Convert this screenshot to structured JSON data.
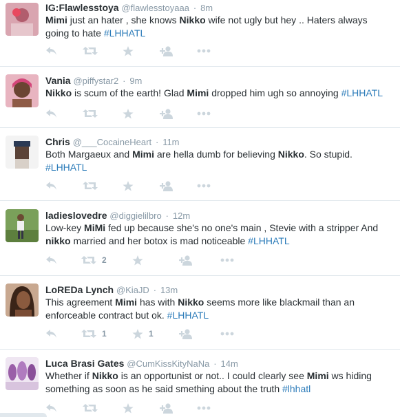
{
  "tweets": [
    {
      "name": "IG:Flawlesstoya",
      "handle": "@flawlesstoyaaa",
      "time": "8m",
      "segments": [
        {
          "t": "Mimi",
          "b": true
        },
        {
          "t": " just an hater , she knows "
        },
        {
          "t": "Nikko",
          "b": true
        },
        {
          "t": " wife not ugly but hey .. Haters always going to hate "
        },
        {
          "t": "#LHHATL",
          "tag": true
        }
      ],
      "retweets": "",
      "favorites": ""
    },
    {
      "name": "Vania",
      "handle": "@piffystar2",
      "time": "9m",
      "segments": [
        {
          "t": "Nikko",
          "b": true
        },
        {
          "t": " is scum of the earth! Glad "
        },
        {
          "t": "Mimi",
          "b": true
        },
        {
          "t": " dropped him ugh so annoying "
        },
        {
          "t": "#LHHATL",
          "tag": true
        }
      ],
      "retweets": "",
      "favorites": ""
    },
    {
      "name": "Chris",
      "handle": "@___CocaineHeart",
      "time": "11m",
      "segments": [
        {
          "t": "Both Margaeux and "
        },
        {
          "t": "Mimi",
          "b": true
        },
        {
          "t": " are hella dumb for believing "
        },
        {
          "t": "Nikko",
          "b": true
        },
        {
          "t": ". So stupid. "
        },
        {
          "t": "#LHHATL",
          "tag": true
        }
      ],
      "retweets": "",
      "favorites": ""
    },
    {
      "name": "ladieslovedre",
      "handle": "@diggielilbro",
      "time": "12m",
      "segments": [
        {
          "t": "Low-key "
        },
        {
          "t": "MiMi",
          "b": true
        },
        {
          "t": " fed up because she's no one's main , Stevie with a stripper And "
        },
        {
          "t": "nikko",
          "b": true
        },
        {
          "t": " married and her botox is mad noticeable "
        },
        {
          "t": "#LHHATL",
          "tag": true
        }
      ],
      "retweets": "2",
      "favorites": ""
    },
    {
      "name": "LoREDa Lynch",
      "handle": "@KiaJD",
      "time": "13m",
      "segments": [
        {
          "t": "This agreement "
        },
        {
          "t": "Mimi",
          "b": true
        },
        {
          "t": " has with "
        },
        {
          "t": "Nikko",
          "b": true
        },
        {
          "t": " seems more like blackmail than an enforceable contract but ok. "
        },
        {
          "t": "#LHHATL",
          "tag": true
        }
      ],
      "retweets": "1",
      "favorites": "1"
    },
    {
      "name": "Luca Brasi Gates",
      "handle": "@CumKissKityNaNa",
      "time": "14m",
      "segments": [
        {
          "t": "Whether if "
        },
        {
          "t": "Nikko",
          "b": true
        },
        {
          "t": " is an opportunist or not.. I could clearly see "
        },
        {
          "t": "Mimi",
          "b": true
        },
        {
          "t": " ws hiding something as soon as he said smething about the truth "
        },
        {
          "t": "#lhhatl",
          "tag": true
        }
      ],
      "retweets": "",
      "favorites": ""
    }
  ],
  "colors": {
    "name": "#292f33",
    "meta": "#8899a6",
    "hashtag": "#2b7bb9",
    "action_icon": "#ccd6dd",
    "divider": "#e1e8ed"
  },
  "icons": [
    "reply-icon",
    "retweet-icon",
    "favorite-icon",
    "follow-icon",
    "more-icon"
  ]
}
